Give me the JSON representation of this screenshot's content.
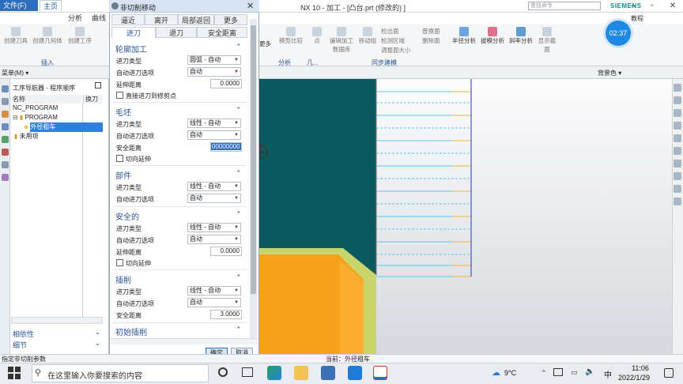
{
  "titlebar": {
    "logo": "NX",
    "title": "NX 10 - 加工 - [凸台.prt  (修改的) ]",
    "brand": "SIEMENS",
    "min": "–",
    "max": "▫",
    "close": "✕"
  },
  "menubar": {
    "file": "文件(F)",
    "tabs": [
      "主页",
      "分析",
      "曲线"
    ],
    "more_tab": "更多",
    "search_placeholder": "查找命令",
    "tutorial": "教程"
  },
  "ribbon": {
    "left_buttons": [
      "创建刀具",
      "创建几何体",
      "创建工序"
    ],
    "left_group": "插入",
    "mid_labels": [
      "更多",
      "模型比较",
      "点",
      "编辑加工数据库",
      "移动组",
      "检出面",
      "删除面",
      "普换面",
      "调整面大小",
      "拉模分析",
      "半径分析",
      "斜率分析",
      "检测区域"
    ],
    "group_labels": [
      "分析",
      "几...",
      "同步建模"
    ],
    "analysis_buttons": [
      "半径分析",
      "拔模分析",
      "斜率分析",
      "显示截面"
    ]
  },
  "toolbar2": {
    "menu": "菜单(M)",
    "bg_label": "背景色"
  },
  "navigator": {
    "title": "工序导航器 - 程序顺序",
    "col_name": "名称",
    "col_tool": "换刀",
    "rows": [
      {
        "label": "NC_PROGRAM"
      },
      {
        "label": "PROGRAM"
      },
      {
        "label": "外径粗车",
        "selected": true
      },
      {
        "label": "未用项"
      }
    ],
    "footer": [
      "相依性",
      "细节"
    ]
  },
  "dialog": {
    "title": "非切削移动",
    "top_tabs": [
      "逼近",
      "离开",
      "局部返回",
      "更多"
    ],
    "sub_tabs": [
      "进刀",
      "退刀",
      "安全距离"
    ],
    "sections": [
      {
        "title": "轮廓加工",
        "rows": [
          {
            "label": "进刀类型",
            "value": "圆弧 - 自动",
            "kind": "select"
          },
          {
            "label": "自动进刀选项",
            "value": "自动",
            "kind": "select"
          },
          {
            "label": "延伸距离",
            "value": "0.0000",
            "kind": "number"
          },
          {
            "label": "直接进刀到修剪点",
            "kind": "check"
          }
        ]
      },
      {
        "title": "毛坯",
        "rows": [
          {
            "label": "进刀类型",
            "value": "线性 - 自动",
            "kind": "select"
          },
          {
            "label": "自动进刀选项",
            "value": "自动",
            "kind": "select"
          },
          {
            "label": "安全距离",
            "value": "00000000",
            "kind": "number",
            "highlight": true
          },
          {
            "label": "切向延伸",
            "kind": "check"
          }
        ]
      },
      {
        "title": "部件",
        "rows": [
          {
            "label": "进刀类型",
            "value": "线性 - 自动",
            "kind": "select"
          },
          {
            "label": "自动进刀选项",
            "value": "自动",
            "kind": "select"
          }
        ]
      },
      {
        "title": "安全的",
        "rows": [
          {
            "label": "进刀类型",
            "value": "线性 - 自动",
            "kind": "select"
          },
          {
            "label": "自动进刀选项",
            "value": "自动",
            "kind": "select"
          },
          {
            "label": "延伸距离",
            "value": "0.0000",
            "kind": "number"
          },
          {
            "label": "切向延伸",
            "kind": "check"
          }
        ]
      },
      {
        "title": "插削",
        "rows": [
          {
            "label": "进刀类型",
            "value": "线性 - 自动",
            "kind": "select"
          },
          {
            "label": "自动进刀选项",
            "value": "自动",
            "kind": "select"
          },
          {
            "label": "安全距离",
            "value": "3.0000",
            "kind": "number"
          }
        ]
      },
      {
        "title": "初始插削",
        "rows": []
      }
    ],
    "ok": "确定",
    "cancel": "取消"
  },
  "status": {
    "left": "指定非切削参数",
    "mid": "当前：外径粗车"
  },
  "timer": "02:37",
  "taskbar": {
    "search": "在这里输入你要搜索的内容",
    "weather": "9°C",
    "ime": "中",
    "time": "11:06",
    "date": "2022/1/29"
  },
  "colors": {
    "part_dark": "#0b5a5f",
    "part_orange": "#f7a21b",
    "part_yellow_green": "#c9d56b",
    "toolpath_blue": "#5cc7ee",
    "toolpath_orange": "#f1b638",
    "accent": "#2f6ebb"
  }
}
